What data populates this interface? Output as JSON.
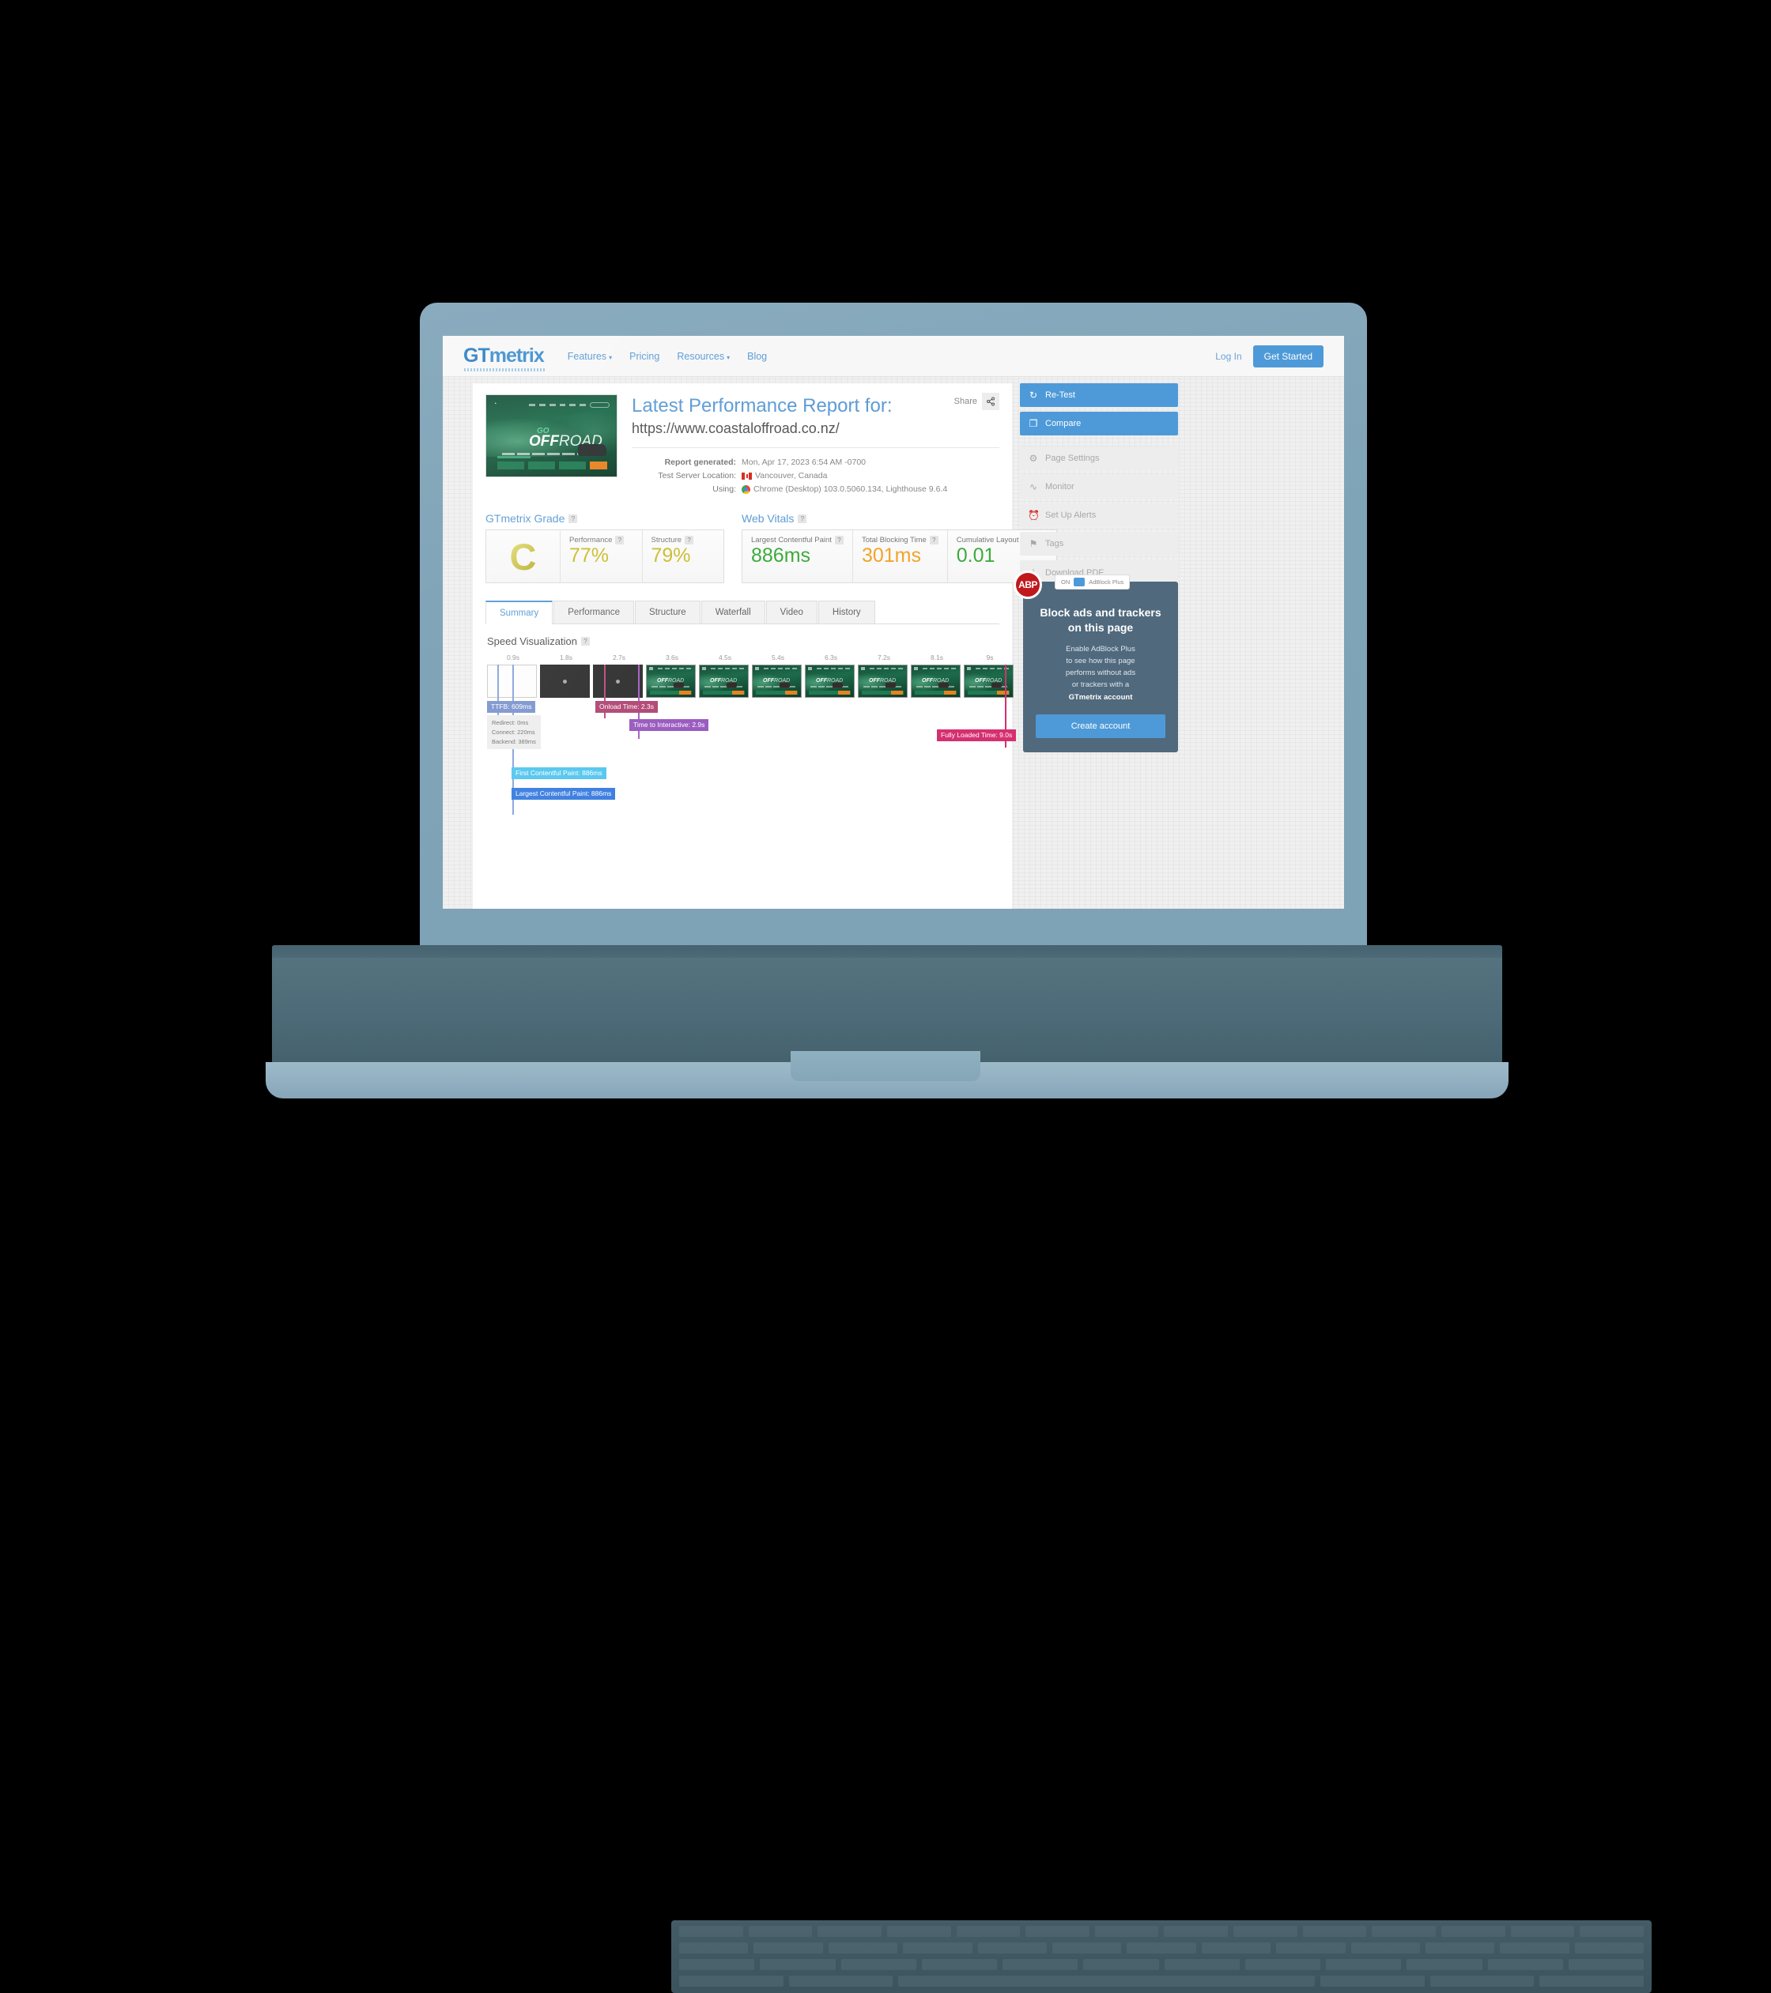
{
  "nav": {
    "brand_gt": "GT",
    "brand_metrix": "metrix",
    "links": [
      {
        "label": "Features",
        "has_caret": true
      },
      {
        "label": "Pricing",
        "has_caret": false
      },
      {
        "label": "Resources",
        "has_caret": true
      },
      {
        "label": "Blog",
        "has_caret": false
      }
    ],
    "login": "Log In",
    "get_started": "Get Started"
  },
  "report": {
    "share_label": "Share",
    "share_icon": "share-icon",
    "title": "Latest Performance Report for:",
    "url": "https://www.coastaloffroad.co.nz/",
    "meta": [
      {
        "label": "Report generated:",
        "value": "Mon, Apr 17, 2023 6:54 AM -0700",
        "icon": ""
      },
      {
        "label": "Test Server Location:",
        "value": "Vancouver, Canada",
        "icon": "canada-flag-icon"
      },
      {
        "label": "Using:",
        "value": "Chrome (Desktop) 103.0.5060.134, Lighthouse 9.6.4",
        "icon": "chrome-icon"
      }
    ],
    "thumbnail": {
      "headline_go": "GO",
      "headline_off": "OFF",
      "headline_road": "ROAD"
    }
  },
  "grade_section": {
    "title": "GTmetrix Grade",
    "help": "?",
    "grade": "C",
    "grade_color": "#cbbe2e",
    "metrics": [
      {
        "label": "Performance",
        "value": "77%",
        "color": "#cbbe2e"
      },
      {
        "label": "Structure",
        "value": "79%",
        "color": "#cbbe2e"
      }
    ]
  },
  "web_vitals": {
    "title": "Web Vitals",
    "help": "?",
    "metrics": [
      {
        "label": "Largest Contentful Paint",
        "value": "886ms",
        "color": "#3cab3c"
      },
      {
        "label": "Total Blocking Time",
        "value": "301ms",
        "color": "#f3a32a"
      },
      {
        "label": "Cumulative Layout Shift",
        "value": "0.01",
        "color": "#3cab3c"
      }
    ]
  },
  "tabs": [
    {
      "label": "Summary",
      "active": true
    },
    {
      "label": "Performance",
      "active": false
    },
    {
      "label": "Structure",
      "active": false
    },
    {
      "label": "Waterfall",
      "active": false
    },
    {
      "label": "Video",
      "active": false
    },
    {
      "label": "History",
      "active": false
    }
  ],
  "speed_visualization": {
    "title": "Speed Visualization",
    "help": "?",
    "ticks": [
      "0.9s",
      "1.8s",
      "2.7s",
      "3.6s",
      "4.5s",
      "5.4s",
      "6.3s",
      "7.2s",
      "8.1s",
      "9s"
    ],
    "frames": [
      "blank",
      "dark",
      "dark",
      "site",
      "site",
      "site",
      "site",
      "site",
      "site",
      "site"
    ],
    "markers": [
      {
        "name": "TTFB",
        "label": "TTFB: 609ms",
        "value_ms": 609,
        "color": "#7f97cf"
      },
      {
        "name": "First Contentful Paint",
        "label": "First Contentful Paint: 886ms",
        "value_ms": 886,
        "color": "#57c7ef"
      },
      {
        "name": "Largest Contentful Paint",
        "label": "Largest Contentful Paint: 886ms",
        "value_ms": 886,
        "color": "#3d7fe0"
      },
      {
        "name": "Onload Time",
        "label": "Onload Time: 2.3s",
        "value_ms": 2300,
        "color": "#b24a77"
      },
      {
        "name": "Time to Interactive",
        "label": "Time to Interactive: 2.9s",
        "value_ms": 2900,
        "color": "#9b5cc0"
      },
      {
        "name": "Fully Loaded Time",
        "label": "Fully Loaded Time: 9.0s",
        "value_ms": 9000,
        "color": "#d62f70"
      }
    ],
    "ttfb_breakdown": [
      "Redirect: 0ms",
      "Connect: 220ms",
      "Backend: 389ms"
    ]
  },
  "sidebar": {
    "actions": [
      {
        "label": "Re-Test",
        "icon": "refresh-icon",
        "glyph": "↻",
        "style": "primary"
      },
      {
        "label": "Compare",
        "icon": "compare-icon",
        "glyph": "❐",
        "style": "primary"
      }
    ],
    "tools": [
      {
        "label": "Page Settings",
        "icon": "gear-icon",
        "glyph": "⚙",
        "style": "muted"
      },
      {
        "label": "Monitor",
        "icon": "pulse-icon",
        "glyph": "∿",
        "style": "muted"
      },
      {
        "label": "Set Up Alerts",
        "icon": "alarm-icon",
        "glyph": "⏰",
        "style": "muted"
      },
      {
        "label": "Tags",
        "icon": "tag-icon",
        "glyph": "⚑",
        "style": "muted"
      },
      {
        "label": "Download PDF",
        "icon": "pdf-icon",
        "glyph": "⤓",
        "style": "muted"
      }
    ]
  },
  "adblock_panel": {
    "logo": "ABP",
    "toggle_state": "ON",
    "toggle_label": "AdBlock Plus",
    "title": "Block ads and trackers on this page",
    "body_lines": [
      "Enable AdBlock Plus",
      "to see how this page",
      "performs without ads",
      "or trackers with a"
    ],
    "body_bold": "GTmetrix account",
    "cta": "Create account"
  }
}
